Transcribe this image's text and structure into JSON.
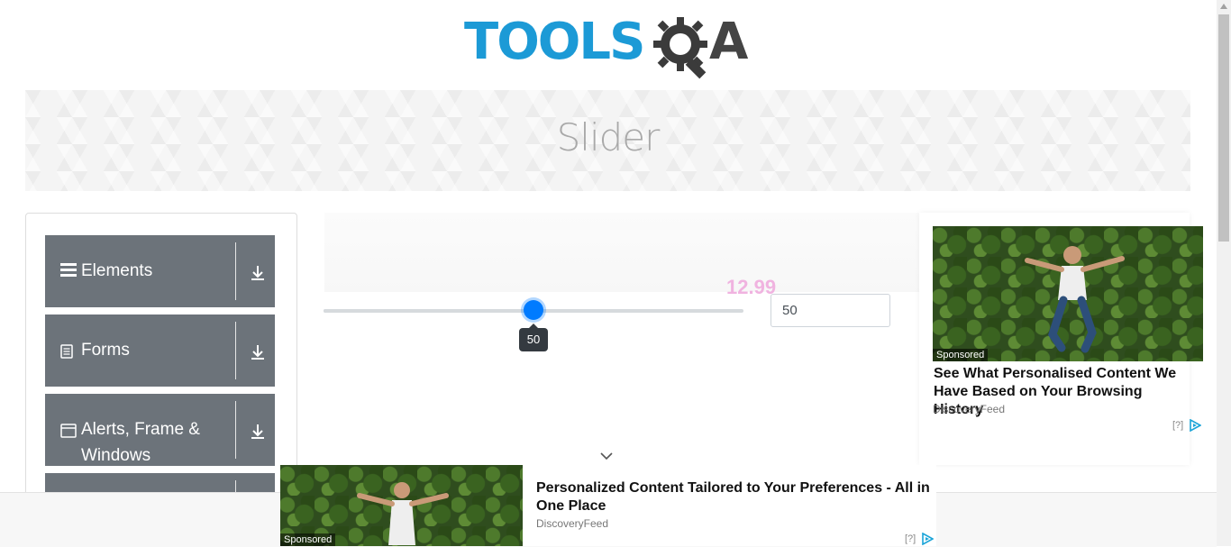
{
  "logo": {
    "brand_left": "TOOLS",
    "brand_right": "A"
  },
  "banner": {
    "title": "Slider"
  },
  "sidebar": {
    "groups": [
      {
        "label": "Elements",
        "icon": "menu-icon"
      },
      {
        "label": "Forms",
        "icon": "document-icon"
      },
      {
        "label": "Alerts, Frame &",
        "label2": "Windows",
        "icon": "window-icon"
      },
      {
        "label": "",
        "icon": ""
      }
    ]
  },
  "slider": {
    "value": 50,
    "min": 0,
    "max": 100,
    "tooltip": "50",
    "input_value": "50",
    "accent": "#007bff"
  },
  "watermark": {
    "text": "12.99"
  },
  "right_ad": {
    "badge": "Sponsored",
    "title": "See What Personalised Content We Have Based on Your Browsing History",
    "source": "DiscoveryFeed",
    "info": "[?]"
  },
  "bottom_ad": {
    "badge": "Sponsored",
    "title": "Personalized Content Tailored to Your Preferences - All in One Place",
    "source": "DiscoveryFeed",
    "info": "[?]"
  },
  "colors": {
    "brand_blue": "#1c9ad6",
    "brand_dark": "#444444",
    "sidebar_bg": "#6c737a"
  }
}
